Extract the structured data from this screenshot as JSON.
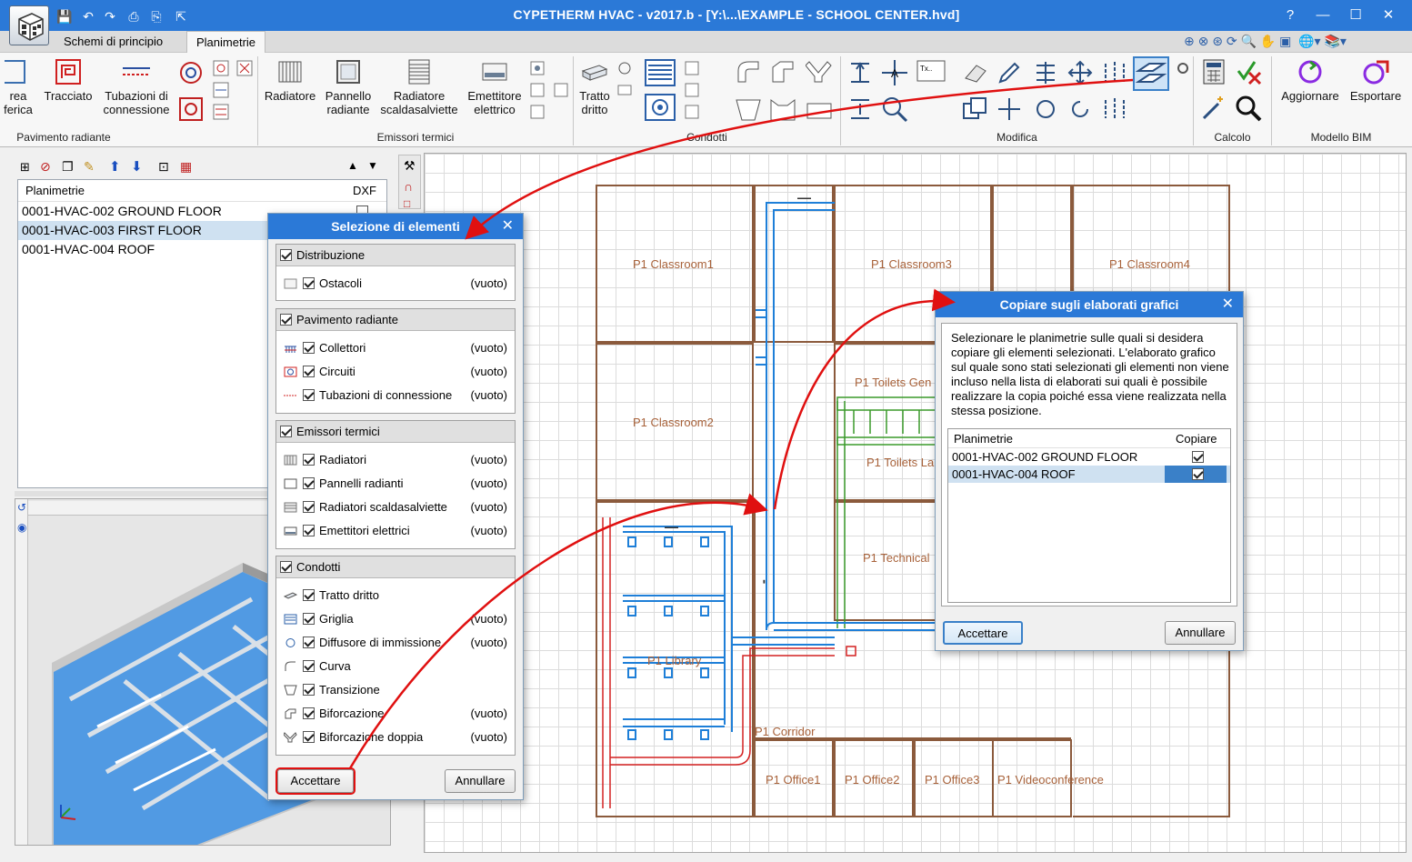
{
  "window": {
    "title": "CYPETHERM HVAC - v2017.b - [Y:\\...\\EXAMPLE - SCHOOL CENTER.hvd]",
    "help": "?",
    "minimize": "—",
    "maximize": "☐",
    "close": "✕"
  },
  "tabs": [
    {
      "label": "Schemi di principio"
    },
    {
      "label": "Planimetrie"
    }
  ],
  "ribbon": {
    "groups": {
      "pavimento": "Pavimento radiante",
      "emissori": "Emissori termici",
      "condotti": "Condotti",
      "modifica": "Modifica",
      "calcolo": "Calcolo",
      "bim": "Modello BIM"
    },
    "buttons": {
      "area_line1": "rea",
      "area_line2": "ferica",
      "tracciato": "Tracciato",
      "tubazioni_line1": "Tubazioni di",
      "tubazioni_line2": "connessione",
      "radiatore": "Radiatore",
      "pannello_line1": "Pannello",
      "pannello_line2": "radiante",
      "scaldasalviette_line1": "Radiatore",
      "scaldasalviette_line2": "scaldasalviette",
      "emettitore_line1": "Emettitore",
      "emettitore_line2": "elettrico",
      "tratto_line1": "Tratto",
      "tratto_line2": "dritto",
      "aggiornare": "Aggiornare",
      "esportare": "Esportare"
    }
  },
  "plan_list": {
    "header": "Planimetrie",
    "dxf_header": "DXF",
    "rows": [
      {
        "label": "0001-HVAC-002 GROUND FLOOR"
      },
      {
        "label": "0001-HVAC-003 FIRST FLOOR"
      },
      {
        "label": "0001-HVAC-004 ROOF"
      }
    ]
  },
  "selection_dialog": {
    "title": "Selezione di elementi",
    "close": "✕",
    "sections": {
      "distribuzione": {
        "label": "Distribuzione",
        "items": [
          {
            "label": "Ostacoli",
            "value": "(vuoto)"
          }
        ]
      },
      "pavimento": {
        "label": "Pavimento radiante",
        "items": [
          {
            "label": "Collettori",
            "value": "(vuoto)"
          },
          {
            "label": "Circuiti",
            "value": "(vuoto)"
          },
          {
            "label": "Tubazioni di connessione",
            "value": "(vuoto)"
          }
        ]
      },
      "emissori": {
        "label": "Emissori termici",
        "items": [
          {
            "label": "Radiatori",
            "value": "(vuoto)"
          },
          {
            "label": "Pannelli radianti",
            "value": "(vuoto)"
          },
          {
            "label": "Radiatori scaldasalviette",
            "value": "(vuoto)"
          },
          {
            "label": "Emettitori elettrici",
            "value": "(vuoto)"
          }
        ]
      },
      "condotti": {
        "label": "Condotti",
        "items": [
          {
            "label": "Tratto dritto",
            "value": ""
          },
          {
            "label": "Griglia",
            "value": "(vuoto)"
          },
          {
            "label": "Diffusore di immissione",
            "value": "(vuoto)"
          },
          {
            "label": "Curva",
            "value": ""
          },
          {
            "label": "Transizione",
            "value": ""
          },
          {
            "label": "Biforcazione",
            "value": "(vuoto)"
          },
          {
            "label": "Biforcazione doppia",
            "value": "(vuoto)"
          }
        ]
      }
    },
    "accept": "Accettare",
    "cancel": "Annullare"
  },
  "copy_dialog": {
    "title": "Copiare sugli elaborati grafici",
    "close": "✕",
    "description": "Selezionare le planimetrie sulle quali si desidera copiare gli elementi selezionati. L'elaborato grafico sul quale sono stati selezionati gli elementi non viene incluso nella lista di elaborati sui quali è possibile realizzare la copia poiché essa viene realizzata nella stessa posizione.",
    "table": {
      "col_plans": "Planimetrie",
      "col_copy": "Copiare",
      "rows": [
        {
          "label": "0001-HVAC-002 GROUND FLOOR",
          "checked": true
        },
        {
          "label": "0001-HVAC-004 ROOF",
          "checked": true
        }
      ]
    },
    "accept": "Accettare",
    "cancel": "Annullare"
  },
  "rooms": {
    "classroom1": "P1 Classroom1",
    "classroom2": "P1 Classroom2",
    "classroom3": "P1 Classroom3",
    "classroom4": "P1 Classroom4",
    "toilets_gen": "P1 Toilets Gen",
    "toilets_la": "P1 Toilets La",
    "technical": "P1 Technical",
    "library": "P1 Library",
    "corridor": "P1 Corridor",
    "office1": "P1 Office1",
    "office2": "P1 Office2",
    "office3": "P1 Office3",
    "videoconference": "P1 Videoconference"
  },
  "colors": {
    "titlebar": "#2b79d7",
    "walls": "#8b5a3c",
    "duct_blue": "#1e7fd8",
    "duct_red": "#d42020",
    "duct_green": "#3a9a2a",
    "annotation_arrow": "#e01010"
  }
}
